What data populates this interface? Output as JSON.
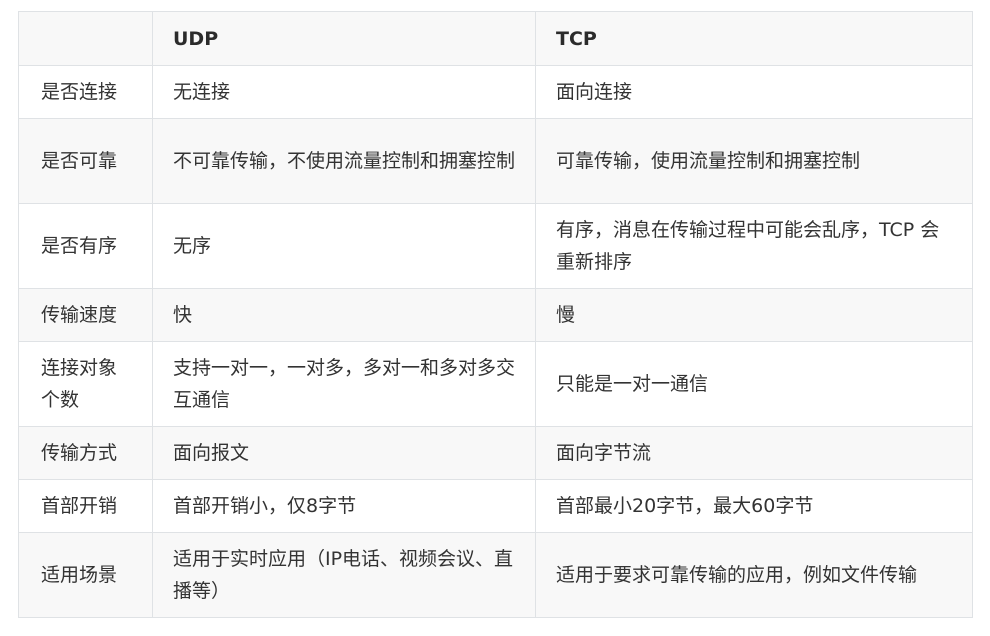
{
  "table": {
    "headers": [
      "",
      "UDP",
      "TCP"
    ],
    "rows": [
      [
        "是否连接",
        "无连接",
        "面向连接"
      ],
      [
        "是否可靠",
        "不可靠传输，不使用流量控制和拥塞控制",
        "可靠传输，使用流量控制和拥塞控制"
      ],
      [
        "是否有序",
        "无序",
        "有序，消息在传输过程中可能会乱序，TCP 会重新排序"
      ],
      [
        "传输速度",
        "快",
        "慢"
      ],
      [
        "连接对象个数",
        "支持一对一，一对多，多对一和多对多交互通信",
        "只能是一对一通信"
      ],
      [
        "传输方式",
        "面向报文",
        "面向字节流"
      ],
      [
        "首部开销",
        "首部开销小，仅8字节",
        "首部最小20字节，最大60字节"
      ],
      [
        "适用场景",
        "适用于实时应用（IP电话、视频会议、直播等）",
        "适用于要求可靠传输的应用，例如文件传输"
      ]
    ]
  }
}
